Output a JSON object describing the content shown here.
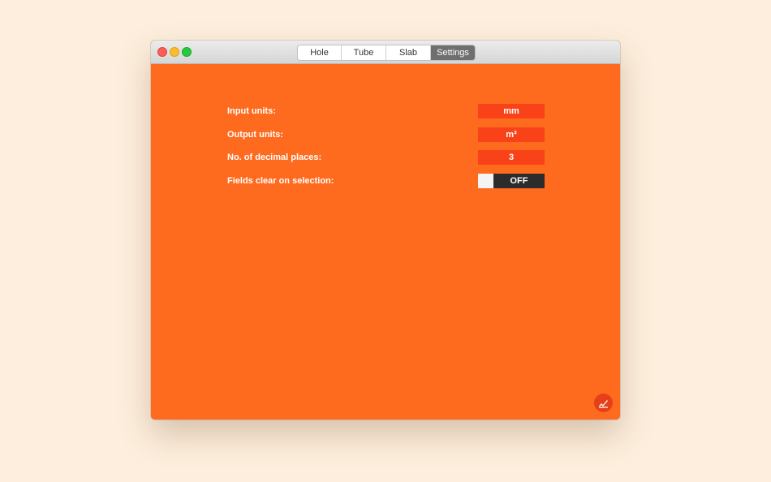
{
  "tabs": [
    {
      "label": "Hole",
      "active": false
    },
    {
      "label": "Tube",
      "active": false
    },
    {
      "label": "Slab",
      "active": false
    },
    {
      "label": "Settings",
      "active": true
    }
  ],
  "settings": {
    "input_units": {
      "label": "Input units:",
      "value": "mm"
    },
    "output_units": {
      "label": "Output units:",
      "value": "m³"
    },
    "decimal_places": {
      "label": "No. of decimal places:",
      "value": "3"
    },
    "fields_clear": {
      "label": "Fields clear on selection:",
      "value": "OFF"
    }
  },
  "colors": {
    "background": "#fdeedd",
    "accent": "#fe6a1e",
    "field": "#fa4219",
    "toggle_off": "#2c2c2c"
  },
  "icons": {
    "logo": "app-logo-icon"
  }
}
